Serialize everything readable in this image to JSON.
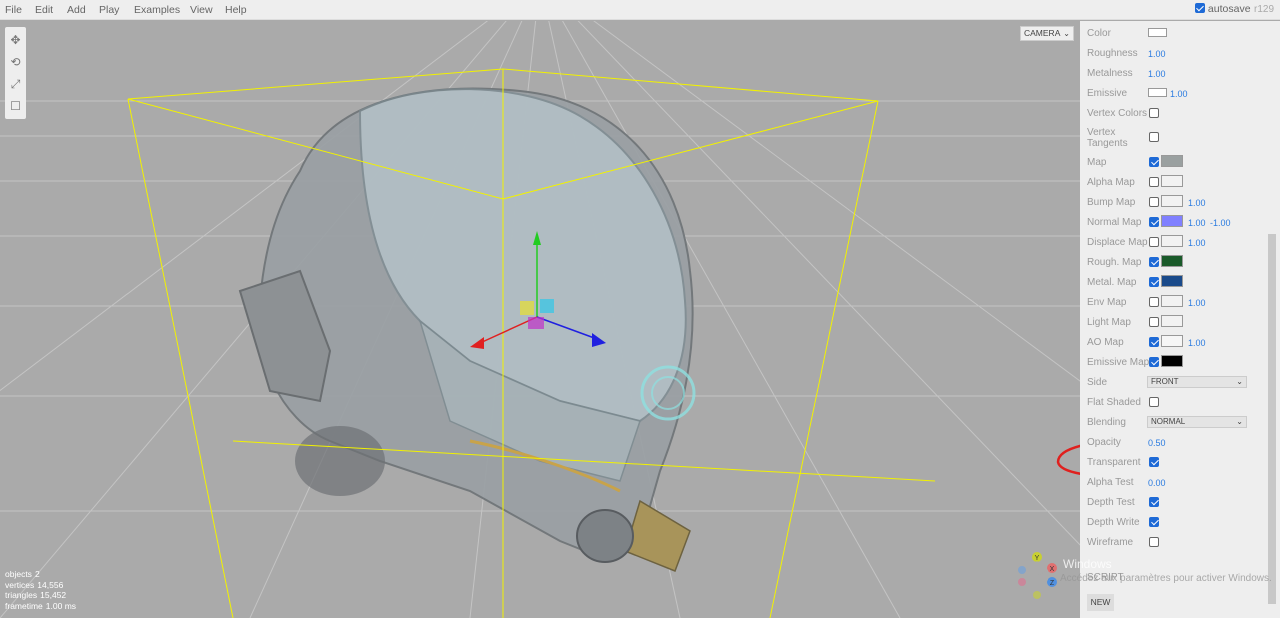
{
  "menubar": {
    "items": [
      "File",
      "Edit",
      "Add",
      "Play",
      "Examples",
      "View",
      "Help"
    ],
    "autosave_label": "autosave",
    "autosave_checked": true,
    "version": "r129"
  },
  "viewport": {
    "camera": "CAMERA",
    "info": {
      "objects_label": "objects",
      "objects": "2",
      "vertices_label": "vertices",
      "vertices": "14,556",
      "triangles_label": "triangles",
      "triangles": "15,452",
      "frametime_label": "frametime",
      "frametime": "1.00 ms"
    },
    "toolbar": [
      "translate-icon",
      "rotate-icon",
      "scale-icon",
      "local-space-icon"
    ],
    "gizmo_axes": [
      "Y",
      "X",
      "Z"
    ]
  },
  "material": {
    "color_label": "Color",
    "roughness_label": "Roughness",
    "roughness": "1.00",
    "metalness_label": "Metalness",
    "metalness": "1.00",
    "emissive_label": "Emissive",
    "emissive_intensity": "1.00",
    "vertex_colors_label": "Vertex Colors",
    "vertex_tangents_label": "Vertex Tangents",
    "map_label": "Map",
    "alpha_map_label": "Alpha Map",
    "bump_map_label": "Bump Map",
    "bump_scale": "1.00",
    "normal_map_label": "Normal Map",
    "normal_x": "1.00",
    "normal_y": "-1.00",
    "displace_map_label": "Displace Map",
    "displace_scale": "1.00",
    "rough_map_label": "Rough. Map",
    "metal_map_label": "Metal. Map",
    "env_map_label": "Env Map",
    "env_intensity": "1.00",
    "light_map_label": "Light Map",
    "ao_map_label": "AO Map",
    "ao_intensity": "1.00",
    "emissive_map_label": "Emissive Map",
    "side_label": "Side",
    "side": "FRONT",
    "flat_shaded_label": "Flat Shaded",
    "blending_label": "Blending",
    "blending": "NORMAL",
    "opacity_label": "Opacity",
    "opacity": "0.50",
    "transparent_label": "Transparent",
    "alpha_test_label": "Alpha Test",
    "alpha_test": "0.00",
    "depth_test_label": "Depth Test",
    "depth_write_label": "Depth Write",
    "wireframe_label": "Wireframe"
  },
  "script": {
    "label": "SCRIPT",
    "new_button": "NEW"
  },
  "watermark": {
    "line1": "Windows",
    "line2": "Accédez aux paramètres pour activer Windows."
  },
  "colors": {
    "accent": "#1e6ad6",
    "value_blue": "#2a7be0",
    "annotation": "#e0201e",
    "bbox": "#f2f200",
    "normal_map": "#8080ff"
  }
}
